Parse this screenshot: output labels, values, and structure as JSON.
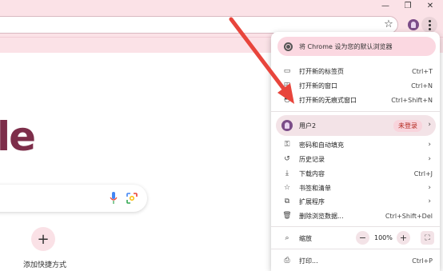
{
  "window": {
    "minimize_glyph": "—",
    "restore_glyph": "❐",
    "close_glyph": "✕"
  },
  "page": {
    "logo_fragment": "le",
    "shortcut_add_glyph": "+",
    "shortcut_label": "添加快捷方式"
  },
  "menu": {
    "default_banner": "将 Chrome 设为您的默认浏览器",
    "items_top": [
      {
        "label": "打开新的标签页",
        "shortcut": "Ctrl+T",
        "icon": "new-tab-icon"
      },
      {
        "label": "打开新的窗口",
        "shortcut": "Ctrl+N",
        "icon": "new-window-icon"
      },
      {
        "label": "打开新的无痕式窗口",
        "shortcut": "Ctrl+Shift+N",
        "icon": "incognito-icon"
      }
    ],
    "profile": {
      "name": "用户2",
      "status": "未登录"
    },
    "items_mid": [
      {
        "label": "密码和自动填充",
        "shortcut": "",
        "icon": "key-icon",
        "submenu": true
      },
      {
        "label": "历史记录",
        "shortcut": "",
        "icon": "history-icon",
        "submenu": true
      },
      {
        "label": "下载内容",
        "shortcut": "Ctrl+J",
        "icon": "download-icon",
        "submenu": false
      },
      {
        "label": "书签和清单",
        "shortcut": "",
        "icon": "bookmark-icon",
        "submenu": true
      },
      {
        "label": "扩展程序",
        "shortcut": "",
        "icon": "extension-icon",
        "submenu": true
      },
      {
        "label": "删除浏览数据...",
        "shortcut": "Ctrl+Shift+Del",
        "icon": "trash-icon",
        "submenu": false
      }
    ],
    "zoom": {
      "label": "缩放",
      "value": "100%",
      "minus": "−",
      "plus": "+"
    },
    "print": {
      "label": "打印...",
      "shortcut": "Ctrl+P"
    }
  },
  "colors": {
    "chrome_frame": "#fbe2e7",
    "accent": "#7b4c88",
    "arrow": "#e8453c",
    "status_text": "#b3261e"
  }
}
